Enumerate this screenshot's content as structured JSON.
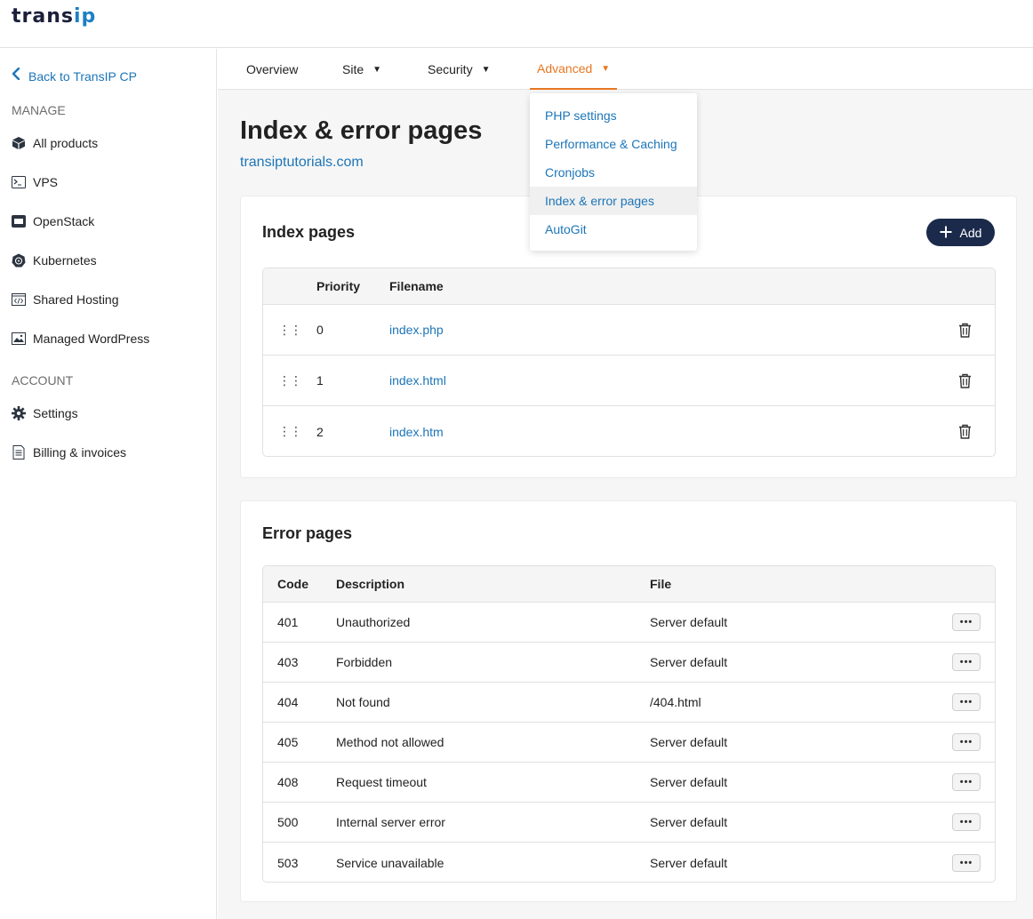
{
  "brand": {
    "logo_part1": "trans",
    "logo_part2": "ip"
  },
  "sidebar": {
    "back_label": "Back to TransIP CP",
    "manage_title": "MANAGE",
    "manage_items": [
      {
        "label": "All products",
        "icon": "box-icon"
      },
      {
        "label": "VPS",
        "icon": "terminal-icon"
      },
      {
        "label": "OpenStack",
        "icon": "openstack-icon"
      },
      {
        "label": "Kubernetes",
        "icon": "kubernetes-icon"
      },
      {
        "label": "Shared Hosting",
        "icon": "code-window-icon"
      },
      {
        "label": "Managed WordPress",
        "icon": "image-icon"
      }
    ],
    "account_title": "ACCOUNT",
    "account_items": [
      {
        "label": "Settings",
        "icon": "gear-icon"
      },
      {
        "label": "Billing & invoices",
        "icon": "invoice-icon"
      }
    ]
  },
  "tabs": [
    {
      "label": "Overview",
      "has_caret": false
    },
    {
      "label": "Site",
      "has_caret": true
    },
    {
      "label": "Security",
      "has_caret": true
    },
    {
      "label": "Advanced",
      "has_caret": true,
      "active": true
    }
  ],
  "dropdown": {
    "items": [
      "PHP settings",
      "Performance & Caching",
      "Cronjobs",
      "Index & error pages",
      "AutoGit"
    ],
    "selected": "Index & error pages"
  },
  "page": {
    "title": "Index & error pages",
    "domain": "transiptutorials.com"
  },
  "index_pages": {
    "title": "Index pages",
    "add_label": "Add",
    "columns": {
      "priority": "Priority",
      "filename": "Filename"
    },
    "rows": [
      {
        "priority": "0",
        "filename": "index.php"
      },
      {
        "priority": "1",
        "filename": "index.html"
      },
      {
        "priority": "2",
        "filename": "index.htm"
      }
    ]
  },
  "error_pages": {
    "title": "Error pages",
    "columns": {
      "code": "Code",
      "description": "Description",
      "file": "File"
    },
    "rows": [
      {
        "code": "401",
        "description": "Unauthorized",
        "file": "Server default"
      },
      {
        "code": "403",
        "description": "Forbidden",
        "file": "Server default"
      },
      {
        "code": "404",
        "description": "Not found",
        "file": "/404.html"
      },
      {
        "code": "405",
        "description": "Method not allowed",
        "file": "Server default"
      },
      {
        "code": "408",
        "description": "Request timeout",
        "file": "Server default"
      },
      {
        "code": "500",
        "description": "Internal server error",
        "file": "Server default"
      },
      {
        "code": "503",
        "description": "Service unavailable",
        "file": "Server default"
      }
    ]
  },
  "colors": {
    "accent": "#e87722",
    "link": "#1c75b8",
    "primary_button": "#1b2a4b"
  }
}
